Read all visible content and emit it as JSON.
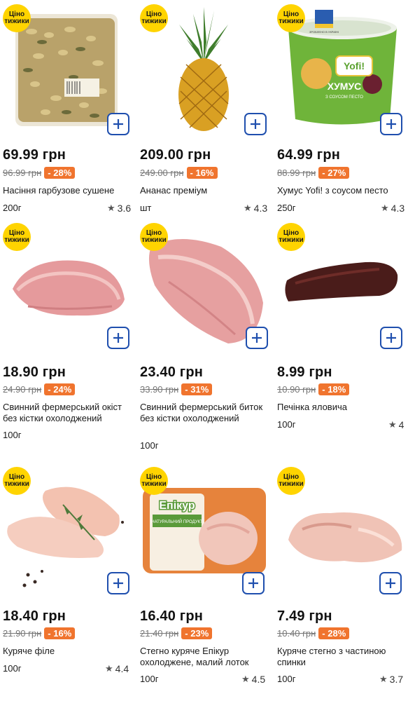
{
  "badge": {
    "line1": "Ціно",
    "line2": "тижики"
  },
  "products": [
    {
      "price": "69.99 грн",
      "old_price": "96.99 грн",
      "discount": "- 28%",
      "name": "Насіння гарбузове сушене",
      "unit": "200г",
      "rating": "3.6"
    },
    {
      "price": "209.00 грн",
      "old_price": "249.00 грн",
      "discount": "- 16%",
      "name": "Ананас преміум",
      "unit": "шт",
      "rating": "4.3"
    },
    {
      "price": "64.99 грн",
      "old_price": "88.99 грн",
      "discount": "- 27%",
      "name": "Хумус Yofi! з соусом песто",
      "unit": "250г",
      "rating": "4.3",
      "pack_brand": "Yofi!",
      "pack_title": "ХУМУС",
      "pack_sub": "З СОУСОМ ПЕСТО",
      "pack_ukraine": "ЗРОБЛЕНО В УКРАЇНІ"
    },
    {
      "price": "18.90 грн",
      "old_price": "24.90 грн",
      "discount": "- 24%",
      "name": "Свинний фермерський окіст без кістки охолоджений",
      "unit": "100г"
    },
    {
      "price": "23.40 грн",
      "old_price": "33.90 грн",
      "discount": "- 31%",
      "name": "Свинний фермерський биток без кістки охолоджений",
      "unit": "100г"
    },
    {
      "price": "8.99 грн",
      "old_price": "10.90 грн",
      "discount": "- 18%",
      "name": "Печінка яловича",
      "unit": "100г",
      "rating": "4"
    },
    {
      "price": "18.40 грн",
      "old_price": "21.90 грн",
      "discount": "- 16%",
      "name": "Куряче філе",
      "unit": "100г",
      "rating": "4.4"
    },
    {
      "price": "16.40 грн",
      "old_price": "21.40 грн",
      "discount": "- 23%",
      "name": "Стегно куряче Епікур охолоджене, малий лоток",
      "unit": "100г",
      "rating": "4.5",
      "pack_brand": "Епікур",
      "pack_label": "НАТУРАЛЬНИЙ ПРОДУКТ"
    },
    {
      "price": "7.49 грн",
      "old_price": "10.40 грн",
      "discount": "- 28%",
      "name": "Куряче стегно з частиною спинки",
      "unit": "100г",
      "rating": "3.7"
    }
  ],
  "icons": {
    "add": "plus-icon",
    "rating": "star-icon"
  },
  "colors": {
    "accent": "#1f4fae",
    "badge": "#ffd400",
    "discount": "#f0742e"
  }
}
